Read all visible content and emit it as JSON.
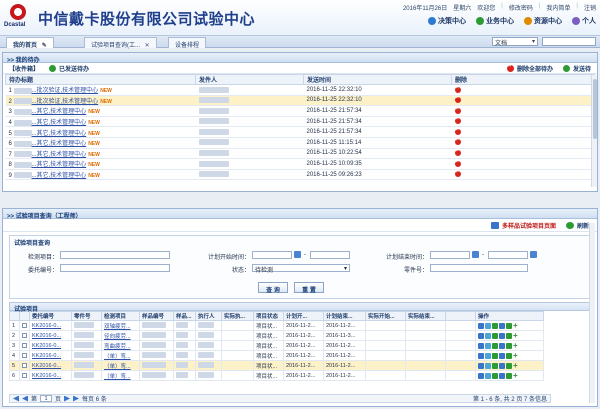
{
  "header": {
    "logo_text": "Dcastal",
    "title": "中信戴卡股份有限公司试验中心",
    "date": "2016年11月26日",
    "weekday": "星期六",
    "greeting": "欢迎您",
    "links": [
      "修改密码",
      "我内简单",
      "注销"
    ],
    "nav": [
      {
        "label": "决策中心",
        "icon": "decision-icon",
        "color": "#2d7ad1"
      },
      {
        "label": "业务中心",
        "icon": "business-icon",
        "color": "#2d9a34"
      },
      {
        "label": "资源中心",
        "icon": "resource-icon",
        "color": "#e08a00"
      },
      {
        "label": "个人",
        "icon": "person-icon",
        "color": "#7a5fc0"
      }
    ]
  },
  "tabs": [
    {
      "label": "我的首页",
      "active": true
    },
    {
      "label": "试验项目查询(工...",
      "active": false
    },
    {
      "label": "设备排程",
      "active": false
    }
  ],
  "doc_select": "文档",
  "todo": {
    "title": ">> 我的待办",
    "tools": {
      "inbox": "【收件箱】",
      "done": "已发送待办",
      "delete_all": "删除全部待办",
      "done_all": "发送待"
    },
    "columns": [
      "待办标题",
      "发件人",
      "发送时间",
      "删除"
    ],
    "rows": [
      {
        "num": "1",
        "title": "...批次验证,技术管理中心",
        "new": "NEW",
        "time": "2016-11-25 22:32:10",
        "highlight": false
      },
      {
        "num": "2",
        "title": "...批次验证,技术管理中心",
        "new": "NEW",
        "time": "2016-11-25 22:32:10",
        "highlight": true
      },
      {
        "num": "3",
        "title": "...其它,技术管理中心",
        "new": "NEW",
        "time": "2016-11-25 21:57:34",
        "highlight": false
      },
      {
        "num": "4",
        "title": "...其它,技术管理中心",
        "new": "NEW",
        "time": "2016-11-25 21:57:34",
        "highlight": false
      },
      {
        "num": "5",
        "title": "...其它,技术管理中心",
        "new": "NEW",
        "time": "2016-11-25 21:57:34",
        "highlight": false
      },
      {
        "num": "6",
        "title": "...其它,技术管理中心",
        "new": "NEW",
        "time": "2016-11-25 11:15:14",
        "highlight": false
      },
      {
        "num": "7",
        "title": "...其它,技术管理中心",
        "new": "NEW",
        "time": "2016-11-25 10:22:54",
        "highlight": false
      },
      {
        "num": "8",
        "title": "...其它,技术管理中心",
        "new": "NEW",
        "time": "2016-11-25 10:09:35",
        "highlight": false
      },
      {
        "num": "9",
        "title": "...其它,技术管理中心",
        "new": "NEW",
        "time": "2016-11-25 09:26:23",
        "highlight": false
      }
    ]
  },
  "query": {
    "title": ">> 试验项目查询（工程师）",
    "multi_sample": "多样品试验项目页面",
    "refresh": "刷新",
    "criteria_title": "试验项目查询",
    "labels": {
      "item": "检测项目：",
      "plan_start": "计划开始时间：",
      "plan_end": "计划结束时间：",
      "entrust_no": "委托编号：",
      "status": "状态：",
      "part_no": "零件号："
    },
    "status_value": "待检测",
    "query_btn": "查 询",
    "reset_btn": "重 置",
    "list_title": "试验项目",
    "columns": [
      "",
      "",
      "委托编号",
      "零件号",
      "检测项目",
      "样品编号",
      "样品...",
      "执行人",
      "实际执...",
      "项目状态",
      "计划开...",
      "计划结束...",
      "实际开始...",
      "实际结束...",
      "",
      "操作"
    ],
    "rows": [
      {
        "num": "1",
        "entrust": "KK2016-0...",
        "item": "双轴疲劳...",
        "status": "项目状...",
        "plan_start": "2016-11-2...",
        "plan_end": "2016-11-2...",
        "highlight": false
      },
      {
        "num": "2",
        "entrust": "KK2016-0...",
        "item": "径向疲劳...",
        "status": "项目状...",
        "plan_start": "2016-11-2...",
        "plan_end": "2016-11-3...",
        "highlight": false
      },
      {
        "num": "3",
        "entrust": "KK2016-0...",
        "item": "弯曲疲劳...",
        "status": "项目状...",
        "plan_start": "2016-11-2...",
        "plan_end": "2016-11-2...",
        "highlight": false
      },
      {
        "num": "4",
        "entrust": "KK2016-0...",
        "item": "（单）弯...",
        "status": "项目状...",
        "plan_start": "2016-11-2...",
        "plan_end": "2016-11-2...",
        "highlight": false
      },
      {
        "num": "5",
        "entrust": "KK2016-0...",
        "item": "（单）弯...",
        "status": "项目状...",
        "plan_start": "2016-11-2...",
        "plan_end": "2016-11-2...",
        "highlight": true
      },
      {
        "num": "6",
        "entrust": "KK2016-0...",
        "item": "（单）弯...",
        "status": "项目状...",
        "plan_start": "2016-11-2...",
        "plan_end": "2016-11-2...",
        "highlight": false
      }
    ],
    "pager": {
      "page_label": "第",
      "page_value": "1",
      "page_suffix": "页",
      "per_page": "每页 6 条",
      "summary": "第 1 - 6 条, 共 2 页 7 条信息"
    }
  }
}
